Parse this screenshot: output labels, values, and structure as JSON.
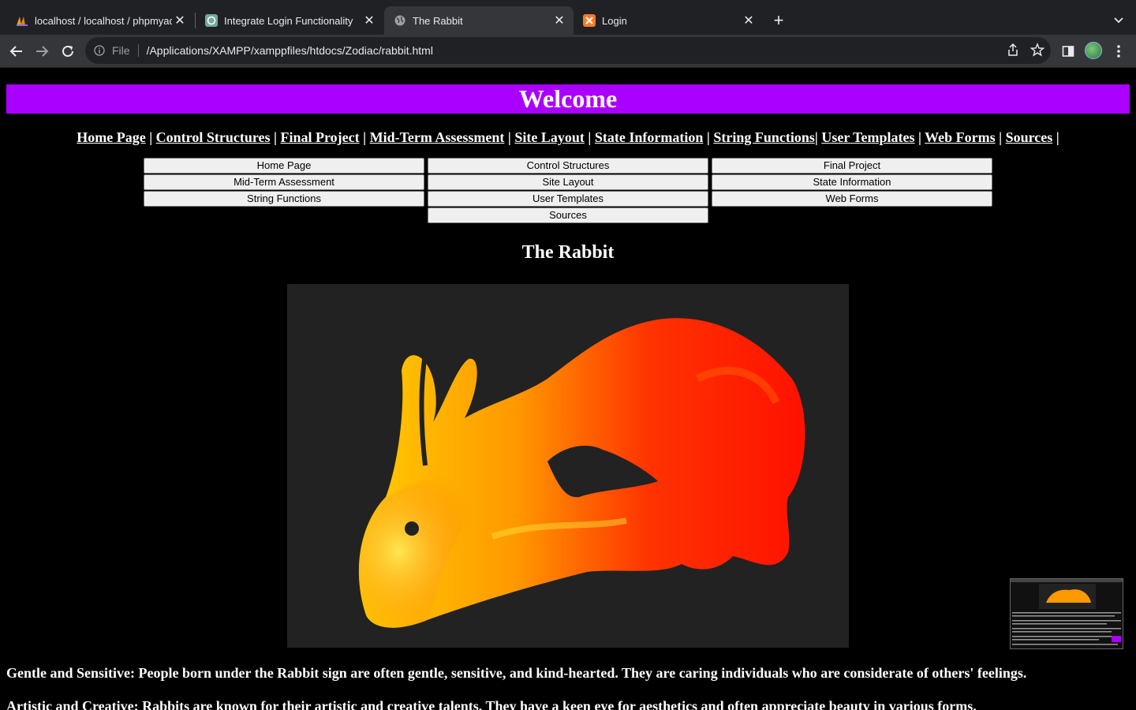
{
  "browser": {
    "tabs": [
      {
        "title": "localhost / localhost / phpmyad",
        "icon": "phpmyadmin-icon"
      },
      {
        "title": "Integrate Login Functionality",
        "icon": "chatgpt-icon"
      },
      {
        "title": "The Rabbit",
        "icon": "globe-icon",
        "active": true
      },
      {
        "title": "Login",
        "icon": "xampp-icon"
      }
    ],
    "address": {
      "scheme_label": "File",
      "url": "/Applications/XAMPP/xamppfiles/htdocs/Zodiac/rabbit.html"
    }
  },
  "page": {
    "banner": "Welcome",
    "links": [
      "Home Page",
      "Control Structures",
      "Final Project",
      "Mid-Term Assessment",
      "Site Layout",
      "State Information",
      "String Functions",
      "User Templates",
      "Web Forms",
      "Sources"
    ],
    "buttons": [
      "Home Page",
      "Control Structures",
      "Final Project",
      "Mid-Term Assessment",
      "Site Layout",
      "State Information",
      "String Functions",
      "User Templates",
      "Web Forms",
      "Sources"
    ],
    "title": "The Rabbit",
    "paragraphs": [
      "Gentle and Sensitive: People born under the Rabbit sign are often gentle, sensitive, and kind-hearted. They are caring individuals who are considerate of others' feelings.",
      "Artistic and Creative: Rabbits are known for their artistic and creative talents. They have a keen eye for aesthetics and often appreciate beauty in various forms."
    ]
  },
  "colors": {
    "banner": "#aa00ff",
    "background": "#000000"
  }
}
